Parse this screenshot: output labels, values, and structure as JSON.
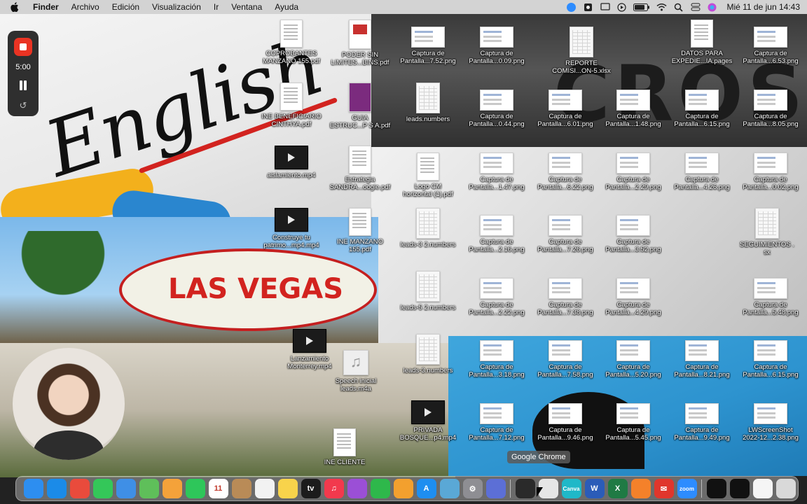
{
  "menubar": {
    "apple_icon": "apple-logo-icon",
    "app_name": "Finder",
    "items": [
      "Archivo",
      "Edición",
      "Visualización",
      "Ir",
      "Ventana",
      "Ayuda"
    ],
    "status_icons": [
      "zoom-icon",
      "gear-icon",
      "screen-icon",
      "play-icon",
      "battery-icon",
      "wifi-icon",
      "search-icon",
      "switch-icon",
      "siri-icon"
    ],
    "clock": "Mié 11 de jun  14:43"
  },
  "recorder": {
    "time": "5:00"
  },
  "desktop_icons": [
    {
      "label1": "COPROBANTES",
      "label2": "MANZANO 155.pdf",
      "kind": "doc"
    },
    {
      "label1": "PODER SIN",
      "label2": "LIMITES...BINS.pdf",
      "kind": "pdfred"
    },
    {
      "label1": "Captura de",
      "label2": "Pantalla...7.52.png",
      "kind": "shot"
    },
    {
      "label1": "Captura de",
      "label2": "Pantalla...0.09.png",
      "kind": "shot"
    },
    {
      "label1": "REPORTE",
      "label2": "COMISI...ON-5.xlsx",
      "kind": "sheet"
    },
    {
      "label1": "DATOS PARA",
      "label2": "EXPEDIE...IA.pages",
      "kind": "doc"
    },
    {
      "label1": "Captura de",
      "label2": "Pantalla...6.53.png",
      "kind": "shot"
    },
    {
      "label1": "INE BENEFICIARIO",
      "label2": "CINTHYA.pdf",
      "kind": "doc"
    },
    {
      "label1": "GUIA",
      "label2": "ESTRUC...P S A.pdf",
      "kind": "purple"
    },
    {
      "label1": "leads.numbers",
      "label2": "",
      "kind": "sheet"
    },
    {
      "label1": "Captura de",
      "label2": "Pantalla...0.44.png",
      "kind": "shot"
    },
    {
      "label1": "Captura de",
      "label2": "Pantalla...6.01.png",
      "kind": "shot"
    },
    {
      "label1": "Captura de",
      "label2": "Pantalla...1.48.png",
      "kind": "shot"
    },
    {
      "label1": "Captura de",
      "label2": "Pantalla...6.15.png",
      "kind": "shot"
    },
    {
      "label1": "Captura de",
      "label2": "Pantalla...8.05.png",
      "kind": "shot"
    },
    {
      "label1": "aislamiento.mp4",
      "label2": "",
      "kind": "video"
    },
    {
      "label1": "Estrategia",
      "label2": "SANDRA...oogle.pdf",
      "kind": "doc"
    },
    {
      "label1": "Logo CM",
      "label2": "horizontal (1).pdf",
      "kind": "doc"
    },
    {
      "label1": "Captura de",
      "label2": "Pantalla...1.47.png",
      "kind": "shot"
    },
    {
      "label1": "Captura de",
      "label2": "Pantalla...6.22.png",
      "kind": "shot"
    },
    {
      "label1": "Captura de",
      "label2": "Pantalla...2.29.png",
      "kind": "shot"
    },
    {
      "label1": "Captura de",
      "label2": "Pantalla...4.26.png",
      "kind": "shot"
    },
    {
      "label1": "Captura de",
      "label2": "Pantalla...0.02.png",
      "kind": "shot"
    },
    {
      "label1": "Construye tu",
      "label2": "patrimo...mp4.mp4",
      "kind": "video"
    },
    {
      "label1": "INE MANZANO",
      "label2": "155.pdf",
      "kind": "doc"
    },
    {
      "label1": "leads-3 2.numbers",
      "label2": "",
      "kind": "sheet"
    },
    {
      "label1": "Captura de",
      "label2": "Pantalla...2.16.png",
      "kind": "shot"
    },
    {
      "label1": "Captura de",
      "label2": "Pantalla...7.26.png",
      "kind": "shot"
    },
    {
      "label1": "Captura de",
      "label2": "Pantalla...3.52.png",
      "kind": "shot"
    },
    {
      "label1": "SEGUIMIENTOS .",
      "label2": "sx",
      "kind": "sheet"
    },
    {
      "label1": "leads-5 2.numbers",
      "label2": "",
      "kind": "sheet"
    },
    {
      "label1": "Captura de",
      "label2": "Pantalla...2.22.png",
      "kind": "shot"
    },
    {
      "label1": "Captura de",
      "label2": "Pantalla...7.38.png",
      "kind": "shot"
    },
    {
      "label1": "Captura de",
      "label2": "Pantalla...4.29.png",
      "kind": "shot"
    },
    {
      "label1": "Captura de",
      "label2": "Pantalla...5.48.png",
      "kind": "shot"
    },
    {
      "label1": "Lanzamiento",
      "label2": "Monterrey.mp4",
      "kind": "video"
    },
    {
      "label1": "Speech inicial",
      "label2": "leads.m4a",
      "kind": "audio"
    },
    {
      "label1": "leads-3.numbers",
      "label2": "",
      "kind": "sheet"
    },
    {
      "label1": "Captura de",
      "label2": "Pantalla...3.18.png",
      "kind": "shot"
    },
    {
      "label1": "Captura de",
      "label2": "Pantalla...7.58.png",
      "kind": "shot"
    },
    {
      "label1": "Captura de",
      "label2": "Pantalla...5.20.png",
      "kind": "shot"
    },
    {
      "label1": "Captura de",
      "label2": "Pantalla...8.21.png",
      "kind": "shot"
    },
    {
      "label1": "Captura de",
      "label2": "Pantalla...6.15.png",
      "kind": "shot"
    },
    {
      "label1": "INE CLIENTE",
      "label2": "",
      "kind": "doc"
    },
    {
      "label1": "PRIVADA",
      "label2": "BOSQUE...p4.mp4",
      "kind": "video"
    },
    {
      "label1": "Captura de",
      "label2": "Pantalla...7.12.png",
      "kind": "shot"
    },
    {
      "label1": "Captura de",
      "label2": "Pantalla...9.46.png",
      "kind": "shot"
    },
    {
      "label1": "Captura de",
      "label2": "Pantalla...5.45.png",
      "kind": "shot"
    },
    {
      "label1": "Captura de",
      "label2": "Pantalla...9.49.png",
      "kind": "shot"
    },
    {
      "label1": "LWScreenShot",
      "label2": "2022-12...2.38.png",
      "kind": "shot"
    }
  ],
  "tooltip": "Google Chrome",
  "dock": {
    "items": [
      {
        "name": "finder-icon",
        "color": "#2d8ef0",
        "glyph": ""
      },
      {
        "name": "safari-icon",
        "color": "#1b8be8",
        "glyph": ""
      },
      {
        "name": "launchpad-icon",
        "color": "#e94b3c",
        "glyph": ""
      },
      {
        "name": "messages-icon",
        "color": "#34c759",
        "glyph": ""
      },
      {
        "name": "mail-icon",
        "color": "#3f8fe6",
        "glyph": ""
      },
      {
        "name": "maps-icon",
        "color": "#5fbf5a",
        "glyph": ""
      },
      {
        "name": "photos-icon",
        "color": "#f4a23a",
        "glyph": ""
      },
      {
        "name": "facetime-icon",
        "color": "#2ec65a",
        "glyph": ""
      },
      {
        "name": "calendar-icon",
        "color": "#ffffff",
        "glyph": "11"
      },
      {
        "name": "contacts-icon",
        "color": "#b98b57",
        "glyph": ""
      },
      {
        "name": "reminders-icon",
        "color": "#f2f2f2",
        "glyph": ""
      },
      {
        "name": "notes-icon",
        "color": "#f8d34b",
        "glyph": ""
      },
      {
        "name": "tv-icon",
        "color": "#1c1c1c",
        "glyph": "tv"
      },
      {
        "name": "music-icon",
        "color": "#f2394d",
        "glyph": "♫"
      },
      {
        "name": "podcasts-icon",
        "color": "#9b4fd6",
        "glyph": ""
      },
      {
        "name": "numbers-icon",
        "color": "#2eb84b",
        "glyph": ""
      },
      {
        "name": "pages-icon",
        "color": "#f3a02e",
        "glyph": ""
      },
      {
        "name": "appstore-icon",
        "color": "#1e8ef0",
        "glyph": "A"
      },
      {
        "name": "preview-icon",
        "color": "#5aa8d6",
        "glyph": ""
      },
      {
        "name": "settings-icon",
        "color": "#8e8e93",
        "glyph": "⚙"
      },
      {
        "name": "imovie-icon",
        "color": "#5c6fd6",
        "glyph": ""
      },
      {
        "name": "quicktime-icon",
        "color": "#2a2a2a",
        "glyph": ""
      },
      {
        "name": "chrome-icon",
        "color": "#e6e6e6",
        "glyph": ""
      },
      {
        "name": "canva-icon",
        "color": "#1fb8c8",
        "glyph": "Canva"
      },
      {
        "name": "word-icon",
        "color": "#2b5cb8",
        "glyph": "W"
      },
      {
        "name": "excel-icon",
        "color": "#1f7a44",
        "glyph": "X"
      },
      {
        "name": "books-icon",
        "color": "#f4812a",
        "glyph": ""
      },
      {
        "name": "mailapp-icon",
        "color": "#e0362c",
        "glyph": "✉"
      },
      {
        "name": "zoom-icon",
        "color": "#2d8cff",
        "glyph": "zoom"
      },
      {
        "name": "window-thumb-1-icon",
        "color": "#111111",
        "glyph": ""
      },
      {
        "name": "window-thumb-2-icon",
        "color": "#111111",
        "glyph": ""
      },
      {
        "name": "window-thumb-3-icon",
        "color": "#f5f5f5",
        "glyph": ""
      },
      {
        "name": "trash-icon",
        "color": "#d9d9d9",
        "glyph": ""
      }
    ]
  }
}
